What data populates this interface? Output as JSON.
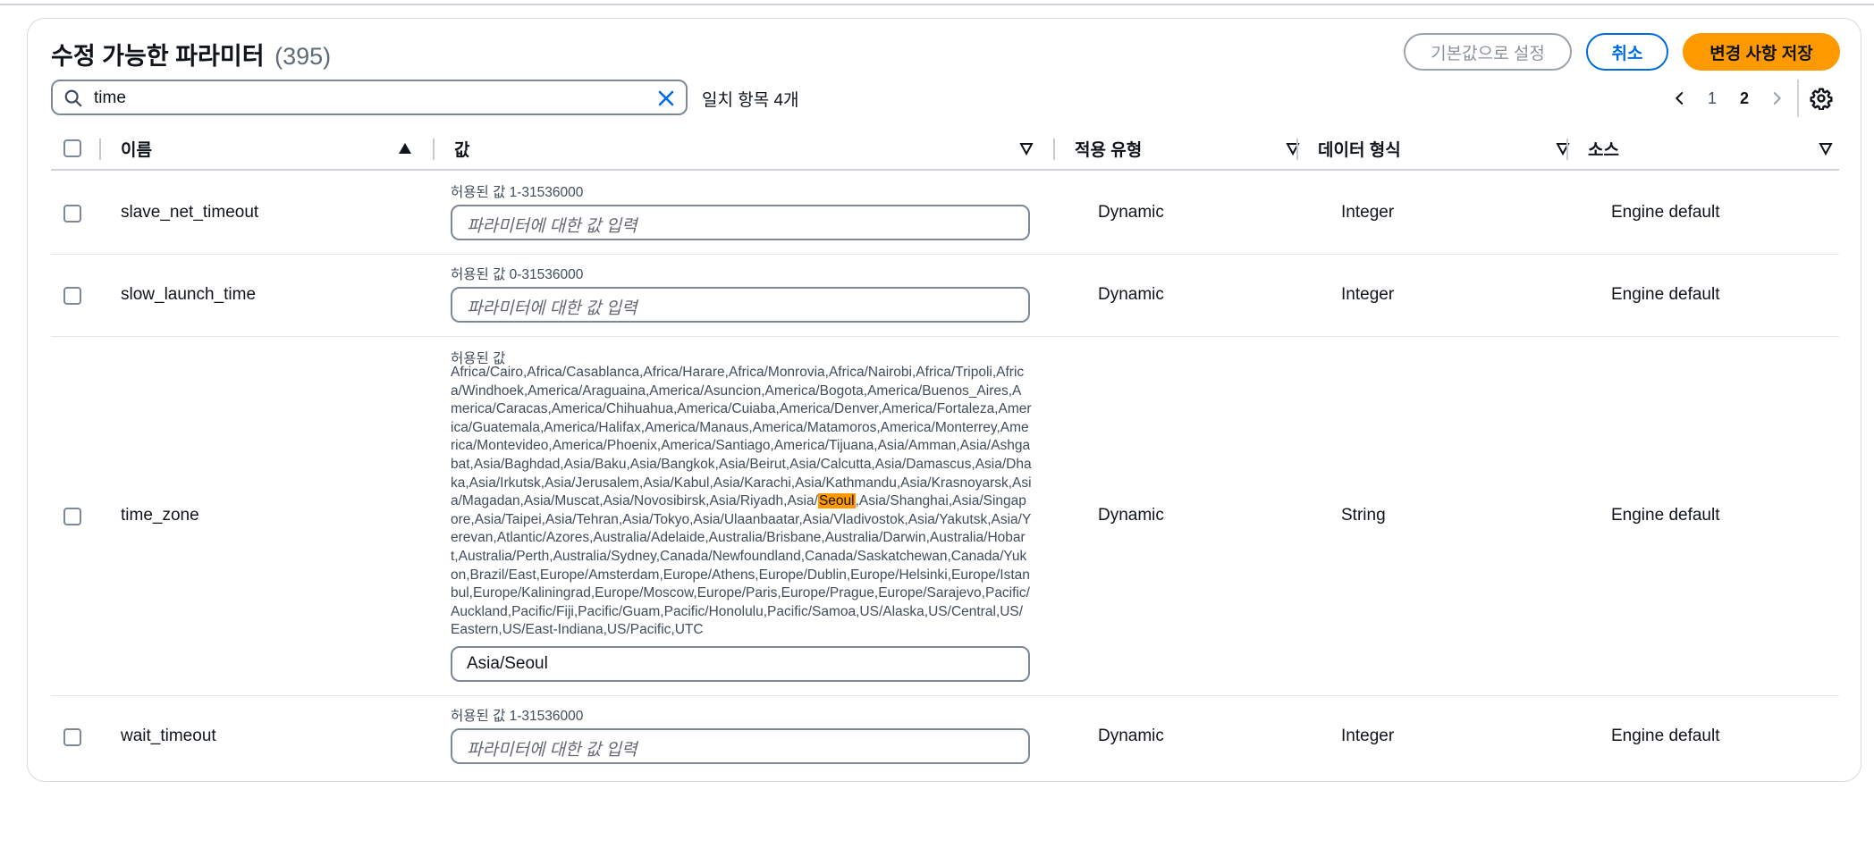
{
  "header": {
    "title": "수정 가능한 파라미터",
    "count": "(395)",
    "buttons": {
      "reset_default": "기본값으로 설정",
      "cancel": "취소",
      "save_changes": "변경 사항 저장"
    }
  },
  "search": {
    "value": "time",
    "match_count": "일치 항목 4개"
  },
  "pagination": {
    "pages": [
      "1",
      "2"
    ],
    "current_page": "2"
  },
  "table": {
    "columns": {
      "name": "이름",
      "value": "값",
      "apply_type": "적용 유형",
      "data_type": "데이터 형식",
      "source": "소스"
    },
    "rows": [
      {
        "name": "slave_net_timeout",
        "allowed_label": "허용된 값 1-31536000",
        "input_placeholder": "파라미터에 대한 값 입력",
        "input_value": "",
        "apply_type": "Dynamic",
        "data_type": "Integer",
        "source": "Engine default"
      },
      {
        "name": "slow_launch_time",
        "allowed_label": "허용된 값 0-31536000",
        "input_placeholder": "파라미터에 대한 값 입력",
        "input_value": "",
        "apply_type": "Dynamic",
        "data_type": "Integer",
        "source": "Engine default"
      },
      {
        "name": "time_zone",
        "allowed_label": "허용된 값",
        "allowed_values_before_highlight": "Africa/Cairo,Africa/Casablanca,Africa/Harare,Africa/Monrovia,Africa/Nairobi,Africa/Tripoli,Africa/Windhoek,America/Araguaina,America/Asuncion,America/Bogota,America/Buenos_Aires,America/Caracas,America/Chihuahua,America/Cuiaba,America/Denver,America/Fortaleza,America/Guatemala,America/Halifax,America/Manaus,America/Matamoros,America/Monterrey,America/Montevideo,America/Phoenix,America/Santiago,America/Tijuana,Asia/Amman,Asia/Ashgabat,Asia/Baghdad,Asia/Baku,Asia/Bangkok,Asia/Beirut,Asia/Calcutta,Asia/Damascus,Asia/Dhaka,Asia/Irkutsk,Asia/Jerusalem,Asia/Kabul,Asia/Karachi,Asia/Kathmandu,Asia/Krasnoyarsk,Asia/Magadan,Asia/Muscat,Asia/Novosibirsk,Asia/Riyadh,Asia/",
        "allowed_values_highlight": "Seoul",
        "allowed_values_after_highlight": ",Asia/Shanghai,Asia/Singapore,Asia/Taipei,Asia/Tehran,Asia/Tokyo,Asia/Ulaanbaatar,Asia/Vladivostok,Asia/Yakutsk,Asia/Yerevan,Atlantic/Azores,Australia/Adelaide,Australia/Brisbane,Australia/Darwin,Australia/Hobart,Australia/Perth,Australia/Sydney,Canada/Newfoundland,Canada/Saskatchewan,Canada/Yukon,Brazil/East,Europe/Amsterdam,Europe/Athens,Europe/Dublin,Europe/Helsinki,Europe/Istanbul,Europe/Kaliningrad,Europe/Moscow,Europe/Paris,Europe/Prague,Europe/Sarajevo,Pacific/Auckland,Pacific/Fiji,Pacific/Guam,Pacific/Honolulu,Pacific/Samoa,US/Alaska,US/Central,US/Eastern,US/East-Indiana,US/Pacific,UTC",
        "input_placeholder": "",
        "input_value": "Asia/Seoul",
        "apply_type": "Dynamic",
        "data_type": "String",
        "source": "Engine default"
      },
      {
        "name": "wait_timeout",
        "allowed_label": "허용된 값 1-31536000",
        "input_placeholder": "파라미터에 대한 값 입력",
        "input_value": "",
        "apply_type": "Dynamic",
        "data_type": "Integer",
        "source": "Engine default"
      }
    ]
  },
  "colors": {
    "accent": "#006ce0",
    "primary_button": "#ff9900",
    "highlight": "#ff9900",
    "border": "#7d8998"
  }
}
